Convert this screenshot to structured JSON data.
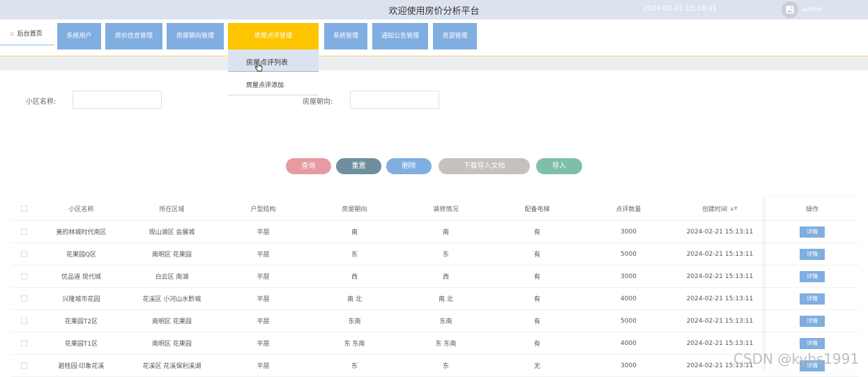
{
  "header": {
    "title": "欢迎使用房价分析平台",
    "datetime": "2024-02-21 15:18:41",
    "username": "admin"
  },
  "nav": {
    "home_label": "后台首页",
    "items": [
      {
        "label": "系统用户"
      },
      {
        "label": "房价信息管理"
      },
      {
        "label": "房屋朝向管理"
      },
      {
        "label": "房屋点评管理"
      },
      {
        "label": "系统管理"
      },
      {
        "label": "通知公告管理"
      },
      {
        "label": "资源管理"
      }
    ],
    "dropdown": [
      "房屋点评列表",
      "房屋点评添加"
    ]
  },
  "filters": {
    "community_label": "小区名称:",
    "community_value": "",
    "orientation_label": "房屋朝向:",
    "orientation_value": ""
  },
  "actions": {
    "query": "查询",
    "reset": "重置",
    "delete": "删除",
    "download": "下载导入文档",
    "import": "导入"
  },
  "table": {
    "columns": [
      "小区名称",
      "所在区域",
      "户型结构",
      "房屋朝向",
      "装修情况",
      "配备电梯",
      "点评数量",
      "创建时间",
      "操作"
    ],
    "detail_label": "详情",
    "rows": [
      [
        "美的林城时代南区",
        "观山湖区 会展城",
        "平层",
        "南",
        "南",
        "有",
        "3000",
        "2024-02-21 15:13:11"
      ],
      [
        "花果园Q区",
        "南明区 花果园",
        "平层",
        "东",
        "东",
        "有",
        "5000",
        "2024-02-21 15:13:11"
      ],
      [
        "优品道 现代城",
        "白云区 南湖",
        "平层",
        "西",
        "西",
        "有",
        "3000",
        "2024-02-21 15:13:11"
      ],
      [
        "兴隆城市花园",
        "花溪区 小河山水黔城",
        "平层",
        "南 北",
        "南 北",
        "有",
        "4000",
        "2024-02-21 15:13:11"
      ],
      [
        "花果园T2区",
        "南明区 花果园",
        "平层",
        "东南",
        "东南",
        "有",
        "5000",
        "2024-02-21 15:13:11"
      ],
      [
        "花果园T1区",
        "南明区 花果园",
        "平层",
        "东 东南",
        "东 东南",
        "有",
        "4000",
        "2024-02-21 15:13:11"
      ],
      [
        "碧桂园·印象花溪",
        "花溪区 花溪保利溪湖",
        "平层",
        "东",
        "东",
        "无",
        "3000",
        "2024-02-21 15:13:11"
      ]
    ]
  },
  "watermark": "CSDN @kybs1991",
  "colors": {
    "topbar": "#dde3ee",
    "nav_button": "#80aee0",
    "nav_active": "#fdc400",
    "btn_query": "#e79aa0",
    "btn_reset": "#6f8f9e",
    "btn_delete": "#80aee0",
    "btn_download": "#c6c1bc",
    "btn_import": "#7fbfa9"
  }
}
